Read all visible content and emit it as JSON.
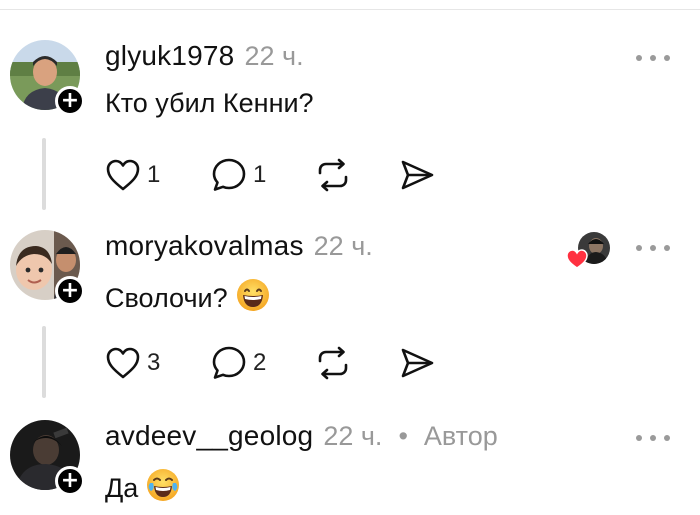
{
  "posts": [
    {
      "username": "glyuk1978",
      "time": "22 ч.",
      "text": "Кто убил Кенни?",
      "likes": "1",
      "replies": "1",
      "follow_symbol": "+"
    },
    {
      "username": "moryakovalmas",
      "time": "22 ч.",
      "text": "Сволочи?",
      "emoji": "grinning-face-emoji",
      "likes": "3",
      "replies": "2",
      "follow_symbol": "+",
      "liked_by_author": true
    },
    {
      "username": "avdeev__geolog",
      "time": "22 ч.",
      "separator": "•",
      "author_label": "Автор",
      "text": "Да",
      "emoji": "tears-of-joy-emoji",
      "follow_symbol": "+"
    }
  ],
  "icons": {
    "like": "heart-icon",
    "reply": "comment-icon",
    "repost": "repost-icon",
    "share": "send-icon",
    "more": "more-icon"
  },
  "colors": {
    "text": "#111111",
    "muted": "#999999",
    "heart_red": "#ff3040",
    "thread_line": "#dcdcdc"
  }
}
